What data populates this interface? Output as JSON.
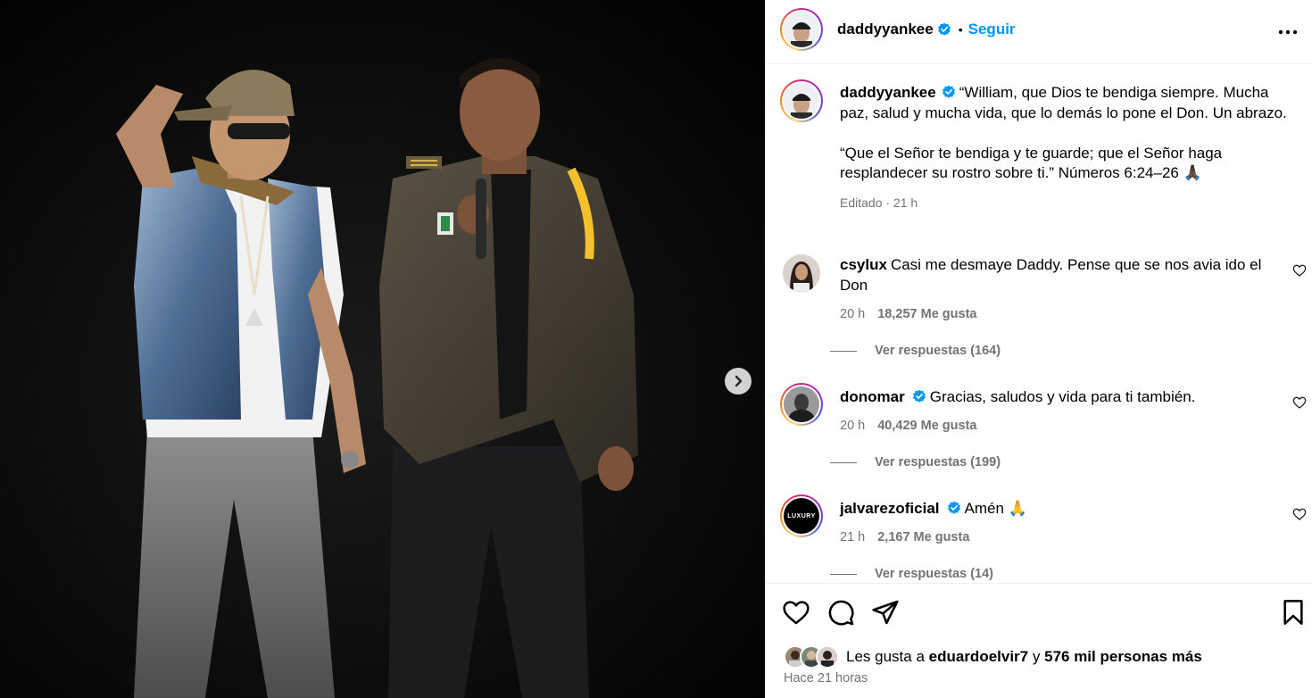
{
  "post": {
    "author": "daddyyankee",
    "follow_label": "Seguir",
    "separator": "•",
    "caption_username": "daddyyankee",
    "caption_text": "“William, que Dios te bendiga siempre. Mucha paz, salud y mucha vida, que lo demás lo pone el Don. Un abrazo.\n\n“Que el Señor te bendiga y te guarde; que el Señor haga resplandecer su rostro sobre ti.” Números 6:24–26 🙏🏿",
    "caption_meta": "Editado · 21 h"
  },
  "comments": [
    {
      "username": "csylux",
      "verified": false,
      "text": "Casi me desmaye Daddy. Pense que se nos avia ido el Don",
      "time": "20 h",
      "likes": "18,257 Me gusta",
      "replies": "Ver respuestas (164)"
    },
    {
      "username": "donomar",
      "verified": true,
      "text": "Gracias, saludos y vida para ti también.",
      "time": "20 h",
      "likes": "40,429 Me gusta",
      "replies": "Ver respuestas (199)"
    },
    {
      "username": "jalvarezoficial",
      "verified": true,
      "text": "Amén 🙏",
      "time": "21 h",
      "likes": "2,167 Me gusta",
      "replies": "Ver respuestas (14)"
    }
  ],
  "likes_summary": {
    "prefix": "Les gusta a",
    "user": "eduardoelvir7",
    "connector": "y",
    "rest": "576 mil personas más"
  },
  "timestamp": "Hace 21 horas",
  "jalvarez_avatar_text": "LUXURY",
  "colors": {
    "follow_blue": "#0095f6",
    "verified_blue": "#0095f6",
    "muted_gray": "#737373"
  },
  "icons": [
    "next-arrow-icon",
    "more-options-icon",
    "verified-badge-icon",
    "heart-icon",
    "comment-icon",
    "share-icon",
    "bookmark-icon"
  ]
}
